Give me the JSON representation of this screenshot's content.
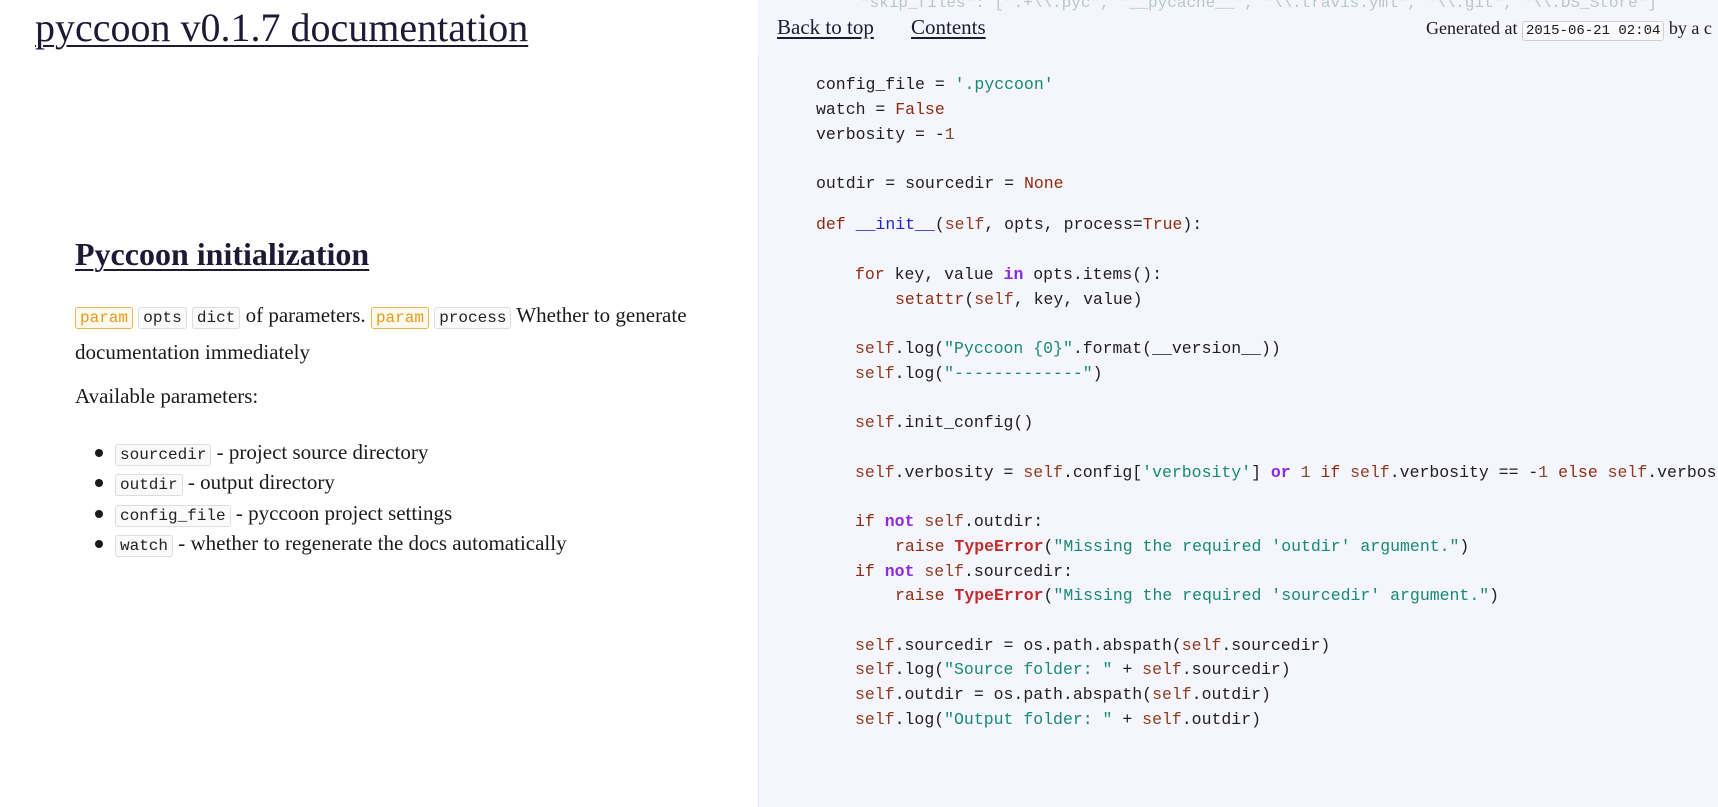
{
  "page": {
    "title": "pyccoon v0.1.7 documentation"
  },
  "topbar": {
    "faded_code": "\"skip_files\": [\".+\\\\.pyc\", \"__pycache__\", \"\\\\.travis.yml\", \"\\\\.git\", \"\\\\.DS_Store\"]",
    "back_to_top": "Back to top",
    "contents": "Contents",
    "generated_prefix": "Generated at",
    "generated_stamp": "2015-06-21 02:04",
    "generated_suffix": "by a c"
  },
  "doc": {
    "section_title": "Pyccoon initialization",
    "param_tag": "param",
    "opts": "opts",
    "dict": "dict",
    "of_params": "of parameters.",
    "process": "process",
    "whether_text": "Whether to generate documentation immediately",
    "available": "Available parameters:",
    "params": [
      {
        "name": "sourcedir",
        "desc": "- project source directory"
      },
      {
        "name": "outdir",
        "desc": "- output directory"
      },
      {
        "name": "config_file",
        "desc": "- pyccoon project settings"
      },
      {
        "name": "watch",
        "desc": "- whether to regenerate the docs automatically"
      }
    ]
  },
  "code_lines": [
    "config_file = '.pyccoon'",
    "watch = False",
    "verbosity = -1",
    "outdir = sourcedir = None",
    "def __init__(self, opts, process=True):",
    "for key, value in opts.items():",
    "setattr(self, key, value)",
    "self.log(\"Pyccoon {0}\".format(__version__))",
    "self.log(\"-------------\")",
    "self.init_config()",
    "self.verbosity = self.config['verbosity'] or 1 if self.verbosity == -1 else self.verbos",
    "if not self.outdir:",
    "raise TypeError(\"Missing the required 'outdir' argument.\")",
    "if not self.sourcedir:",
    "raise TypeError(\"Missing the required 'sourcedir' argument.\")",
    "self.sourcedir = os.path.abspath(self.sourcedir)",
    "self.log(\"Source folder: \" + self.sourcedir)",
    "self.outdir = os.path.abspath(self.outdir)",
    "self.log(\"Output folder: \" + self.outdir)"
  ],
  "colors": {
    "link": "#1d1a36",
    "param_tag": "#e69a1e",
    "code_bg": "#f5f5fd",
    "string": "#168a72",
    "keyword": "#8a2be2",
    "exception": "#c12c2c",
    "function": "#2323d0"
  }
}
